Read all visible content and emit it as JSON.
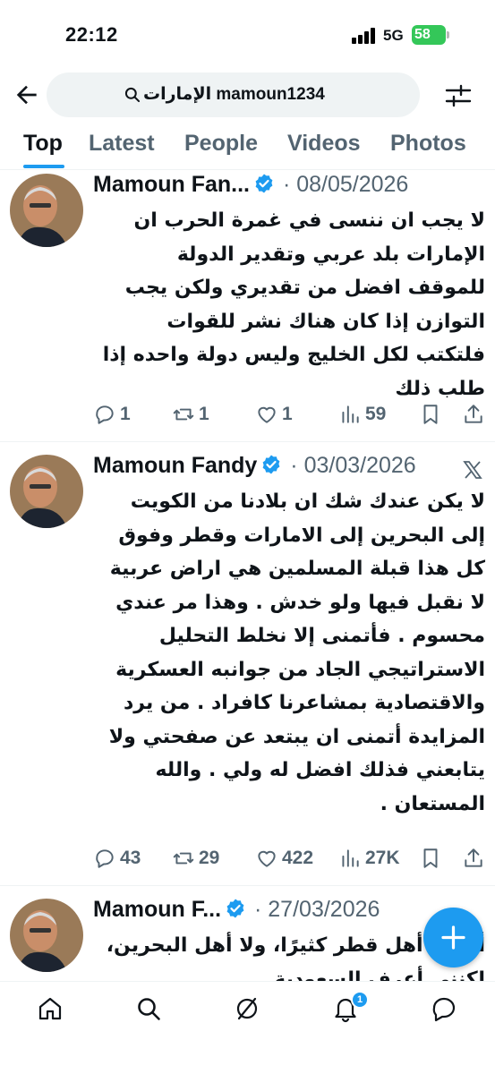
{
  "status_bar": {
    "time": "22:12",
    "network": "5G",
    "battery": "58"
  },
  "search": {
    "query": "الإمارات mamoun1234"
  },
  "tabs": [
    {
      "label": "Top",
      "active": true
    },
    {
      "label": "Latest",
      "active": false
    },
    {
      "label": "People",
      "active": false
    },
    {
      "label": "Videos",
      "active": false
    },
    {
      "label": "Photos",
      "active": false
    }
  ],
  "tweets": [
    {
      "name": "Mamoun Fan...",
      "sep": " · ",
      "date": "08/05/2026",
      "text": "لا يجب ان ننسى في غمرة الحرب ان الإمارات بلد عربي وتقدير الدولة للموقف افضل من تقديري ولكن يجب التوازن إذا كان هناك نشر للقوات فلتكتب لكل الخليج وليس دولة واحده إذا طلب ذلك",
      "replies": "1",
      "reposts": "1",
      "likes": "1",
      "views": "59"
    },
    {
      "name": "Mamoun Fandy",
      "sep": " · ",
      "date": "03/03/2026",
      "text": "لا يكن عندك شك ان بلادنا من الكويت إلى البحرين إلى الامارات وقطر  وفوق كل هذا قبلة المسلمين هي اراض عربية لا نقبل فيها ولو خدش . وهذا مر عندي محسوم . فأتمنى إلا نخلط التحليل الاستراتيجي الجاد من جوانبه العسكرية والاقتصادية بمشاعرنا كافراد . من يرد المزايدة أتمنى ان يبتعد عن صفحتي ولا يتابعني فذلك افضل له ولي . والله المستعان .",
      "replies": "43",
      "reposts": "29",
      "likes": "422",
      "views": "27K"
    },
    {
      "name": "Mamoun F...",
      "sep": " · ",
      "date": "27/03/2026",
      "text": "أعرف أهل قطر كثيرًا، ولا أهل البحرين، لكنني أعرف السعودية"
    }
  ],
  "notifications_badge": "1",
  "colors": {
    "accent": "#1d9bf0",
    "muted": "#536471",
    "text": "#0f1419",
    "battery": "#34c759"
  }
}
